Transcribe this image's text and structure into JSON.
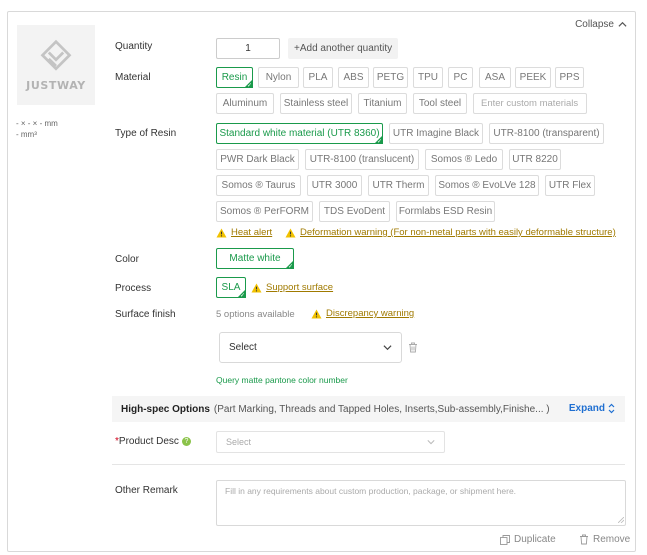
{
  "header": {
    "collapse_label": "Collapse"
  },
  "thumbnail": {
    "logo_text": "JUSTWAY"
  },
  "dimensions": {
    "size_line": "- × - × - mm",
    "volume_line": "- mm³"
  },
  "quantity": {
    "label": "Quantity",
    "value": "1",
    "add_label": "+Add another quantity"
  },
  "material": {
    "label": "Material",
    "options": [
      "Resin",
      "Nylon",
      "PLA",
      "ABS",
      "PETG",
      "TPU",
      "PC",
      "ASA",
      "PEEK",
      "PPS",
      "Aluminum",
      "Stainless steel",
      "Titanium",
      "Tool steel"
    ],
    "selected": "Resin",
    "custom_placeholder": "Enter custom materials"
  },
  "resin_type": {
    "label": "Type of Resin",
    "options": [
      "Standard white material (UTR 8360)",
      "UTR Imagine Black",
      "UTR-8100 (transparent)",
      "PWR Dark Black",
      "UTR-8100 (translucent)",
      "Somos ® Ledo",
      "UTR 8220",
      "Somos ® Taurus",
      "UTR 3000",
      "UTR Therm",
      "Somos ® EvoLVe 128",
      "UTR Flex",
      "Somos ® PerFORM",
      "TDS EvoDent",
      "Formlabs ESD Resin"
    ],
    "selected": "Standard white material (UTR 8360)",
    "warnings": [
      "Heat alert",
      "Deformation warning (For non-metal parts with easily deformable structure)"
    ]
  },
  "color": {
    "label": "Color",
    "selected": "Matte white"
  },
  "process": {
    "label": "Process",
    "selected": "SLA",
    "warning": "Support surface"
  },
  "surface_finish": {
    "label": "Surface finish",
    "available_text": "5 options available",
    "warning": "Discrepancy warning",
    "select_value": "Select",
    "query_link": "Query matte pantone color number"
  },
  "high_spec": {
    "title": "High-spec Options",
    "description": "(Part Marking, Threads and Tapped Holes, Inserts,Sub-assembly,Finishe...  )",
    "expand_label": "Expand"
  },
  "product_desc": {
    "required_mark": "*",
    "label": "Product Desc",
    "help": "?",
    "placeholder": "Select"
  },
  "remark": {
    "label": "Other Remark",
    "placeholder": "Fill in any requirements about custom production, package, or shipment here."
  },
  "footer": {
    "duplicate_label": "Duplicate",
    "remove_label": "Remove"
  },
  "colors": {
    "accent_green": "#1a9a4b",
    "link_blue": "#1f6fd1",
    "warning_amber": "#a07a00",
    "required_red": "#d0021b"
  },
  "icons": [
    "chevron-up-icon",
    "warning-icon",
    "chevron-down-icon",
    "trash-icon",
    "help-icon",
    "copy-icon"
  ]
}
